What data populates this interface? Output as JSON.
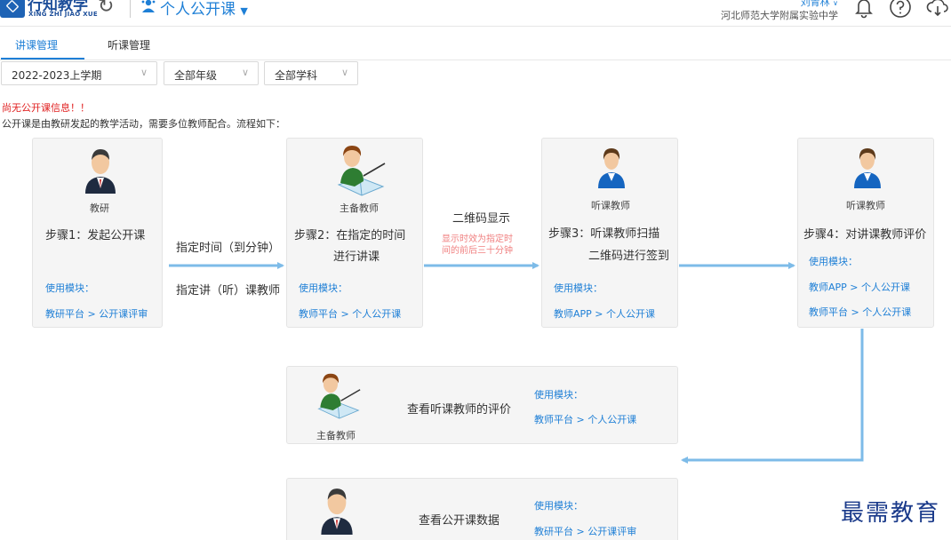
{
  "header": {
    "brand_cn": "行知教学",
    "brand_en": "XING ZHI JIAO XUE",
    "app_title": "个人公开课",
    "user_name": "刘青林",
    "school": "河北师范大学附属实验中学",
    "icons": [
      "refresh-icon",
      "bell-icon",
      "help-icon",
      "cloud-download-icon"
    ]
  },
  "tabs": [
    {
      "label": "讲课管理",
      "active": true
    },
    {
      "label": "听课管理",
      "active": false
    }
  ],
  "filters": {
    "term": "2022-2023上学期",
    "grade": "全部年级",
    "subject": "全部学科"
  },
  "notice": "尚无公开课信息！！",
  "description": "公开课是由教研发起的教学活动，需要多位教师配合。流程如下：",
  "flow": {
    "step1": {
      "role": "教研",
      "step": "步骤1：发起公开课",
      "module_label": "使用模块：",
      "module_path": "教研平台 > 公开课评审"
    },
    "link1": {
      "label_top": "指定时间（到分钟）",
      "label_bottom": "指定讲（听）课教师"
    },
    "step2": {
      "role": "主备教师",
      "step_line1": "步骤2：在指定的时间",
      "step_line2": "进行讲课",
      "module_label": "使用模块：",
      "module_path": "教师平台 > 个人公开课"
    },
    "link2": {
      "label": "二维码显示",
      "note_line1": "显示时效为指定时",
      "note_line2": "间的前后三十分钟"
    },
    "step3": {
      "role": "听课教师",
      "step_line1": "步骤3：听课教师扫描",
      "step_line2": "二维码进行签到",
      "module_label": "使用模块：",
      "module_path": "教师APP > 个人公开课"
    },
    "step4": {
      "role": "听课教师",
      "step": "步骤4：对讲课教师评价",
      "module_label": "使用模块：",
      "module_path_1": "教师APP > 个人公开课",
      "module_path_2": "教师平台 > 个人公开课"
    },
    "step5": {
      "role": "主备教师",
      "step": "查看听课教师的评价",
      "module_label": "使用模块：",
      "module_path": "教师平台 > 个人公开课"
    },
    "step6": {
      "step": "查看公开课数据",
      "module_label": "使用模块：",
      "module_path": "教研平台 > 公开课评审"
    }
  },
  "watermark": "最需教育",
  "colors": {
    "accent": "#1e7fd6",
    "arrow": "#7dbbe8",
    "notice": "#e02020",
    "note": "#f08080"
  }
}
